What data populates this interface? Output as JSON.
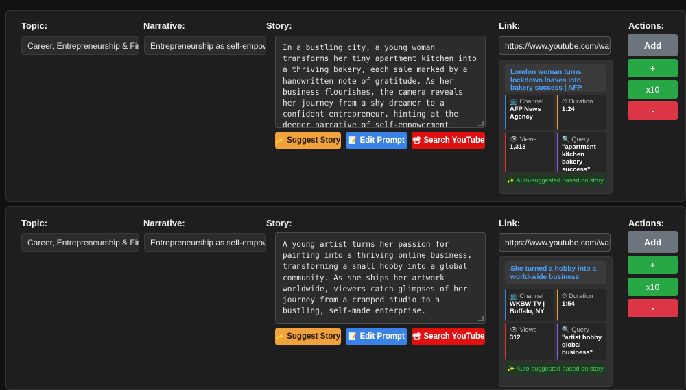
{
  "labels": {
    "topic": "Topic:",
    "narrative": "Narrative:",
    "story": "Story:",
    "link": "Link:",
    "actions": "Actions:"
  },
  "buttons": {
    "suggest": "Suggest Story",
    "edit": "Edit Prompt",
    "search": "Search YouTube",
    "suggest_icon": "✨",
    "edit_icon": "📝",
    "search_icon": "📽"
  },
  "actions": {
    "add": "Add",
    "plus": "+",
    "x10": "x10",
    "minus": "-"
  },
  "meta_labels": {
    "channel": "Channel",
    "duration": "Duration",
    "views": "Views",
    "query": "Query",
    "channel_icon": "📺",
    "duration_icon": "⏱",
    "views_icon": "👁",
    "query_icon": "🔍"
  },
  "rows": [
    {
      "topic": "Career, Entrepreneurship & Finance",
      "narrative": "Entrepreneurship as self-empowerment",
      "story": "In a bustling city, a young woman transforms her tiny apartment kitchen into a thriving bakery, each sale marked by a handwritten note of gratitude. As her business flourishes, the camera reveals her journey from a shy dreamer to a confident entrepreneur, hinting at the deeper narrative of self-empowerment through her newfound independence.",
      "link": "https://www.youtube.com/watch?",
      "video": {
        "title": "London woman turns lockdown loaves into bakery success | AFP",
        "channel": "AFP News Agency",
        "duration": "1:24",
        "views": "1,313",
        "query": "\"apartment kitchen bakery success\"",
        "note": "✨ Auto-suggested based on story"
      }
    },
    {
      "topic": "Career, Entrepreneurship & Finance",
      "narrative": "Entrepreneurship as self-empowerment",
      "story": "A young artist turns her passion for painting into a thriving online business, transforming a small hobby into a global community. As she ships her artwork worldwide, viewers catch glimpses of her journey from a cramped studio to a bustling, self-made enterprise.",
      "link": "https://www.youtube.com/watch?",
      "video": {
        "title": "She turned a hobby into a world-wide business",
        "channel": "WKBW TV | Buffalo, NY",
        "duration": "1:54",
        "views": "312",
        "query": "\"artist hobby global business\"",
        "note": "✨ Auto-suggested based on story"
      }
    }
  ]
}
